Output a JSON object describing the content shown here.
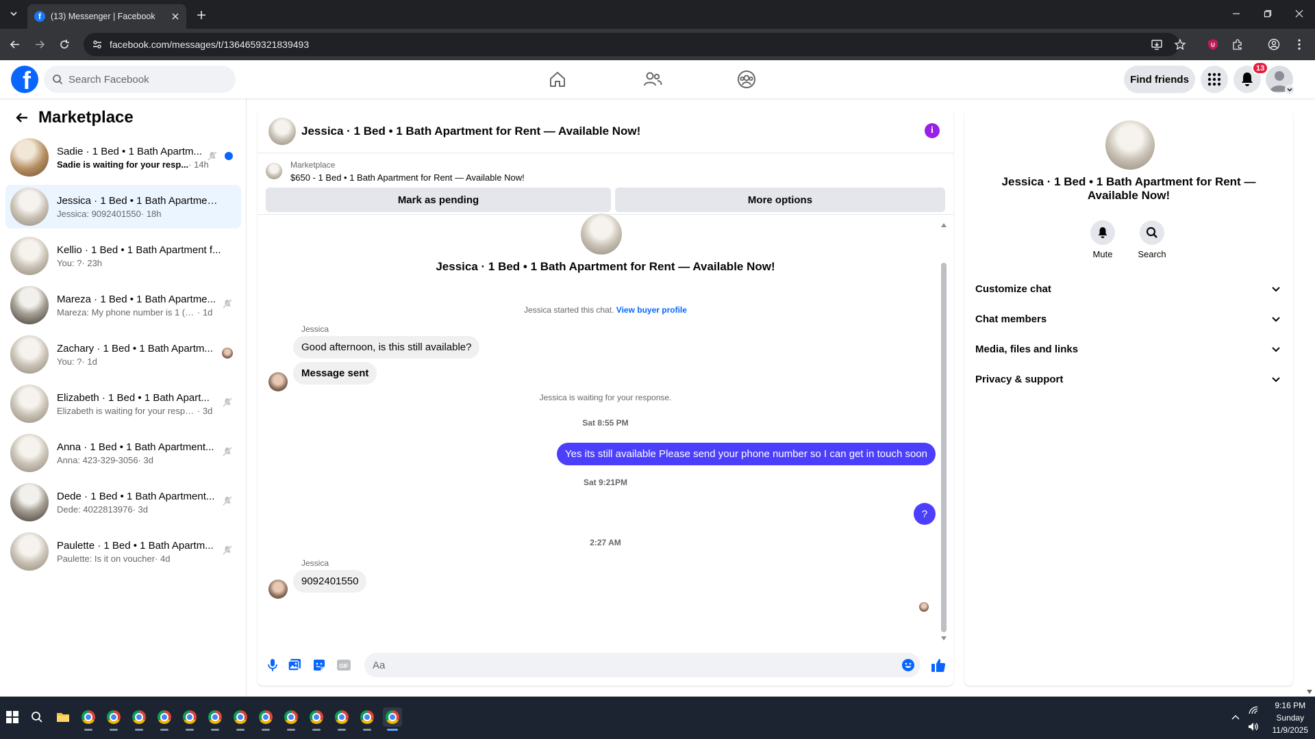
{
  "browser": {
    "tab_title": "(13) Messenger | Facebook",
    "url": "facebook.com/messages/t/1364659321839493"
  },
  "fb_header": {
    "search_placeholder": "Search Facebook",
    "find_friends": "Find friends",
    "notification_count": "13"
  },
  "sidebar": {
    "title": "Marketplace",
    "conversations": [
      {
        "name": "Sadie · 1 Bed • 1 Bath Apartm...",
        "preview": "Sadie is waiting for your resp...",
        "time": "· 14h",
        "unread": true
      },
      {
        "name": "Jessica · 1 Bed • 1 Bath Apartment ...",
        "preview": "Jessica: 9092401550",
        "time": "· 18h",
        "active": true
      },
      {
        "name": "Kellio · 1 Bed • 1 Bath Apartment f...",
        "preview": "You: ?",
        "time": "· 23h"
      },
      {
        "name": "Mareza · 1 Bed • 1 Bath Apartme...",
        "preview": "Mareza: My phone number is 1 (90...",
        "time": "· 1d"
      },
      {
        "name": "Zachary · 1 Bed • 1 Bath Apartm...",
        "preview": "You: ?",
        "time": "· 1d"
      },
      {
        "name": "Elizabeth · 1 Bed • 1 Bath Apart...",
        "preview": "Elizabeth is waiting for your respo...",
        "time": "· 3d"
      },
      {
        "name": "Anna · 1 Bed • 1 Bath Apartment...",
        "preview": "Anna: 423-329-3056",
        "time": "· 3d"
      },
      {
        "name": "Dede · 1 Bed • 1 Bath Apartment...",
        "preview": "Dede: 4022813976",
        "time": "· 3d"
      },
      {
        "name": "Paulette · 1 Bed • 1 Bath Apartm...",
        "preview": "Paulette: Is it on voucher",
        "time": "· 4d"
      }
    ]
  },
  "chat": {
    "title": "Jessica · 1 Bed • 1 Bath Apartment for Rent — Available Now!",
    "marketplace_label": "Marketplace",
    "listing": "$650 - 1 Bed • 1 Bath Apartment for Rent — Available Now!",
    "mark_pending": "Mark as pending",
    "more_options": "More options",
    "thread_title": "Jessica · 1 Bed • 1 Bath Apartment for Rent — Available Now!",
    "started_text": "Jessica started this chat.",
    "view_profile": "View buyer profile",
    "sender_name": "Jessica",
    "msg1": "Good afternoon, is this still available?",
    "msg2": "Message sent",
    "waiting_text": "Jessica is waiting for your response.",
    "time1": "Sat 8:55 PM",
    "msg3": "Yes its still available Please send your phone number so I can get in touch soon",
    "time2": "Sat 9:21PM",
    "msg4": "?",
    "time3": "2:27 AM",
    "sender_name2": "Jessica",
    "msg5": "9092401550",
    "composer_placeholder": "Aa"
  },
  "details": {
    "title": "Jessica · 1 Bed • 1 Bath Apartment for Rent — Available Now!",
    "mute": "Mute",
    "search": "Search",
    "rows": [
      "Customize chat",
      "Chat members",
      "Media, files and links",
      "Privacy & support"
    ]
  },
  "taskbar": {
    "time": "9:16 PM",
    "day": "Sunday",
    "date": "11/9/2025"
  },
  "colors": {
    "fb_blue": "#0866ff",
    "outgoing_bubble": "#4b3ffb",
    "info_purple": "#9b1fe8",
    "badge_red": "#e41e3f"
  }
}
